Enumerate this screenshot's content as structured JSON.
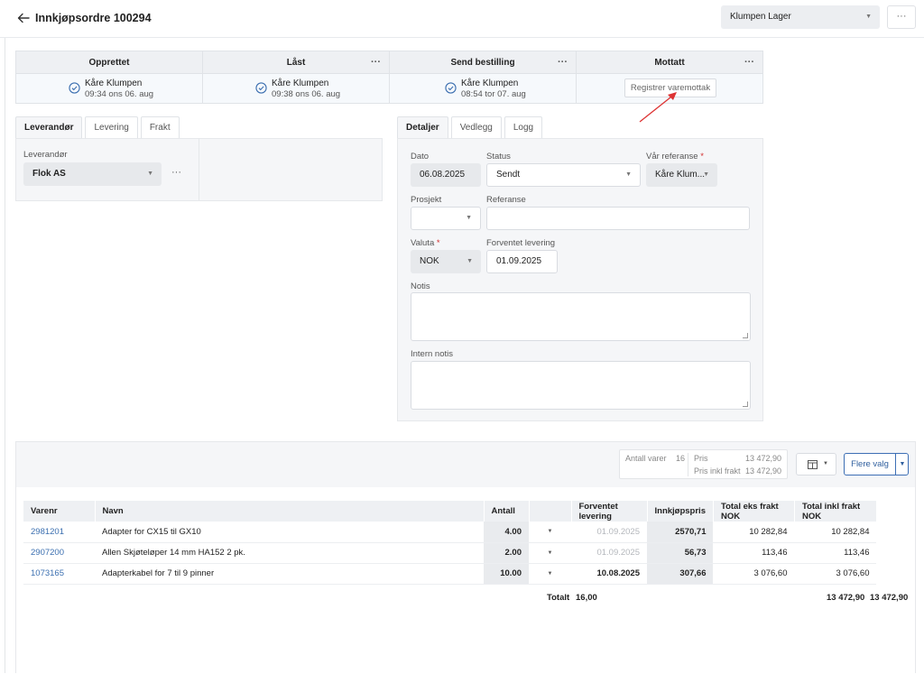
{
  "header": {
    "title": "Innkjøpsordre 100294",
    "warehouse": "Klumpen Lager",
    "more_label": "···"
  },
  "status": [
    {
      "title": "Opprettet",
      "has_menu": false,
      "name": "Kåre Klumpen",
      "time": "09:34 ons 06. aug"
    },
    {
      "title": "Låst",
      "has_menu": true,
      "name": "Kåre Klumpen",
      "time": "09:38 ons 06. aug"
    },
    {
      "title": "Send bestilling",
      "has_menu": true,
      "name": "Kåre Klumpen",
      "time": "08:54 tor 07. aug"
    },
    {
      "title": "Mottatt",
      "has_menu": true,
      "button": "Registrer varemottak"
    }
  ],
  "dots": "···",
  "left_tabs": [
    "Leverandør",
    "Levering",
    "Frakt"
  ],
  "supplier": {
    "label": "Leverandør",
    "value": "Flok AS"
  },
  "right_tabs": [
    "Detaljer",
    "Vedlegg",
    "Logg"
  ],
  "details": {
    "date_label": "Dato",
    "date_value": "06.08.2025",
    "status_label": "Status",
    "status_value": "Sendt",
    "ref_label": "Vår referanse",
    "ref_value": "Kåre Klum...",
    "project_label": "Prosjekt",
    "project_value": "",
    "reference_label": "Referanse",
    "reference_value": "",
    "currency_label": "Valuta",
    "currency_value": "NOK",
    "expected_label": "Forventet levering",
    "expected_value": "01.09.2025",
    "note_label": "Notis",
    "internal_note_label": "Intern notis"
  },
  "summary": {
    "count_label": "Antall varer",
    "count_value": "16",
    "price_label": "Pris",
    "price_value": "13 472,90",
    "price_incl_label": "Pris inkl frakt",
    "price_incl_value": "13 472,90"
  },
  "more_options_label": "Flere valg",
  "lines": {
    "headers": [
      "Varenr",
      "Navn",
      "Antall",
      "",
      "Forventet levering",
      "Innkjøpspris",
      "Total eks frakt NOK",
      "Total inkl frakt NOK"
    ],
    "rows": [
      {
        "varenr": "2981201",
        "navn": "Adapter for CX15 til GX10",
        "antall": "4.00",
        "levering": "01.09.2025",
        "levering_muted": true,
        "pris": "2570,71",
        "total_eks": "10 282,84",
        "total_inkl": "10 282,84"
      },
      {
        "varenr": "2907200",
        "navn": "Allen Skjøteløper 14 mm HA152 2 pk.",
        "antall": "2.00",
        "levering": "01.09.2025",
        "levering_muted": true,
        "pris": "56,73",
        "total_eks": "113,46",
        "total_inkl": "113,46"
      },
      {
        "varenr": "1073165",
        "navn": "Adapterkabel for 7 til 9 pinner",
        "antall": "10.00",
        "levering": "10.08.2025",
        "levering_muted": false,
        "pris": "307,66",
        "total_eks": "3 076,60",
        "total_inkl": "3 076,60"
      }
    ],
    "total_label": "Totalt",
    "total_qty": "16,00",
    "total_eks": "13 472,90",
    "total_inkl": "13 472,90"
  }
}
